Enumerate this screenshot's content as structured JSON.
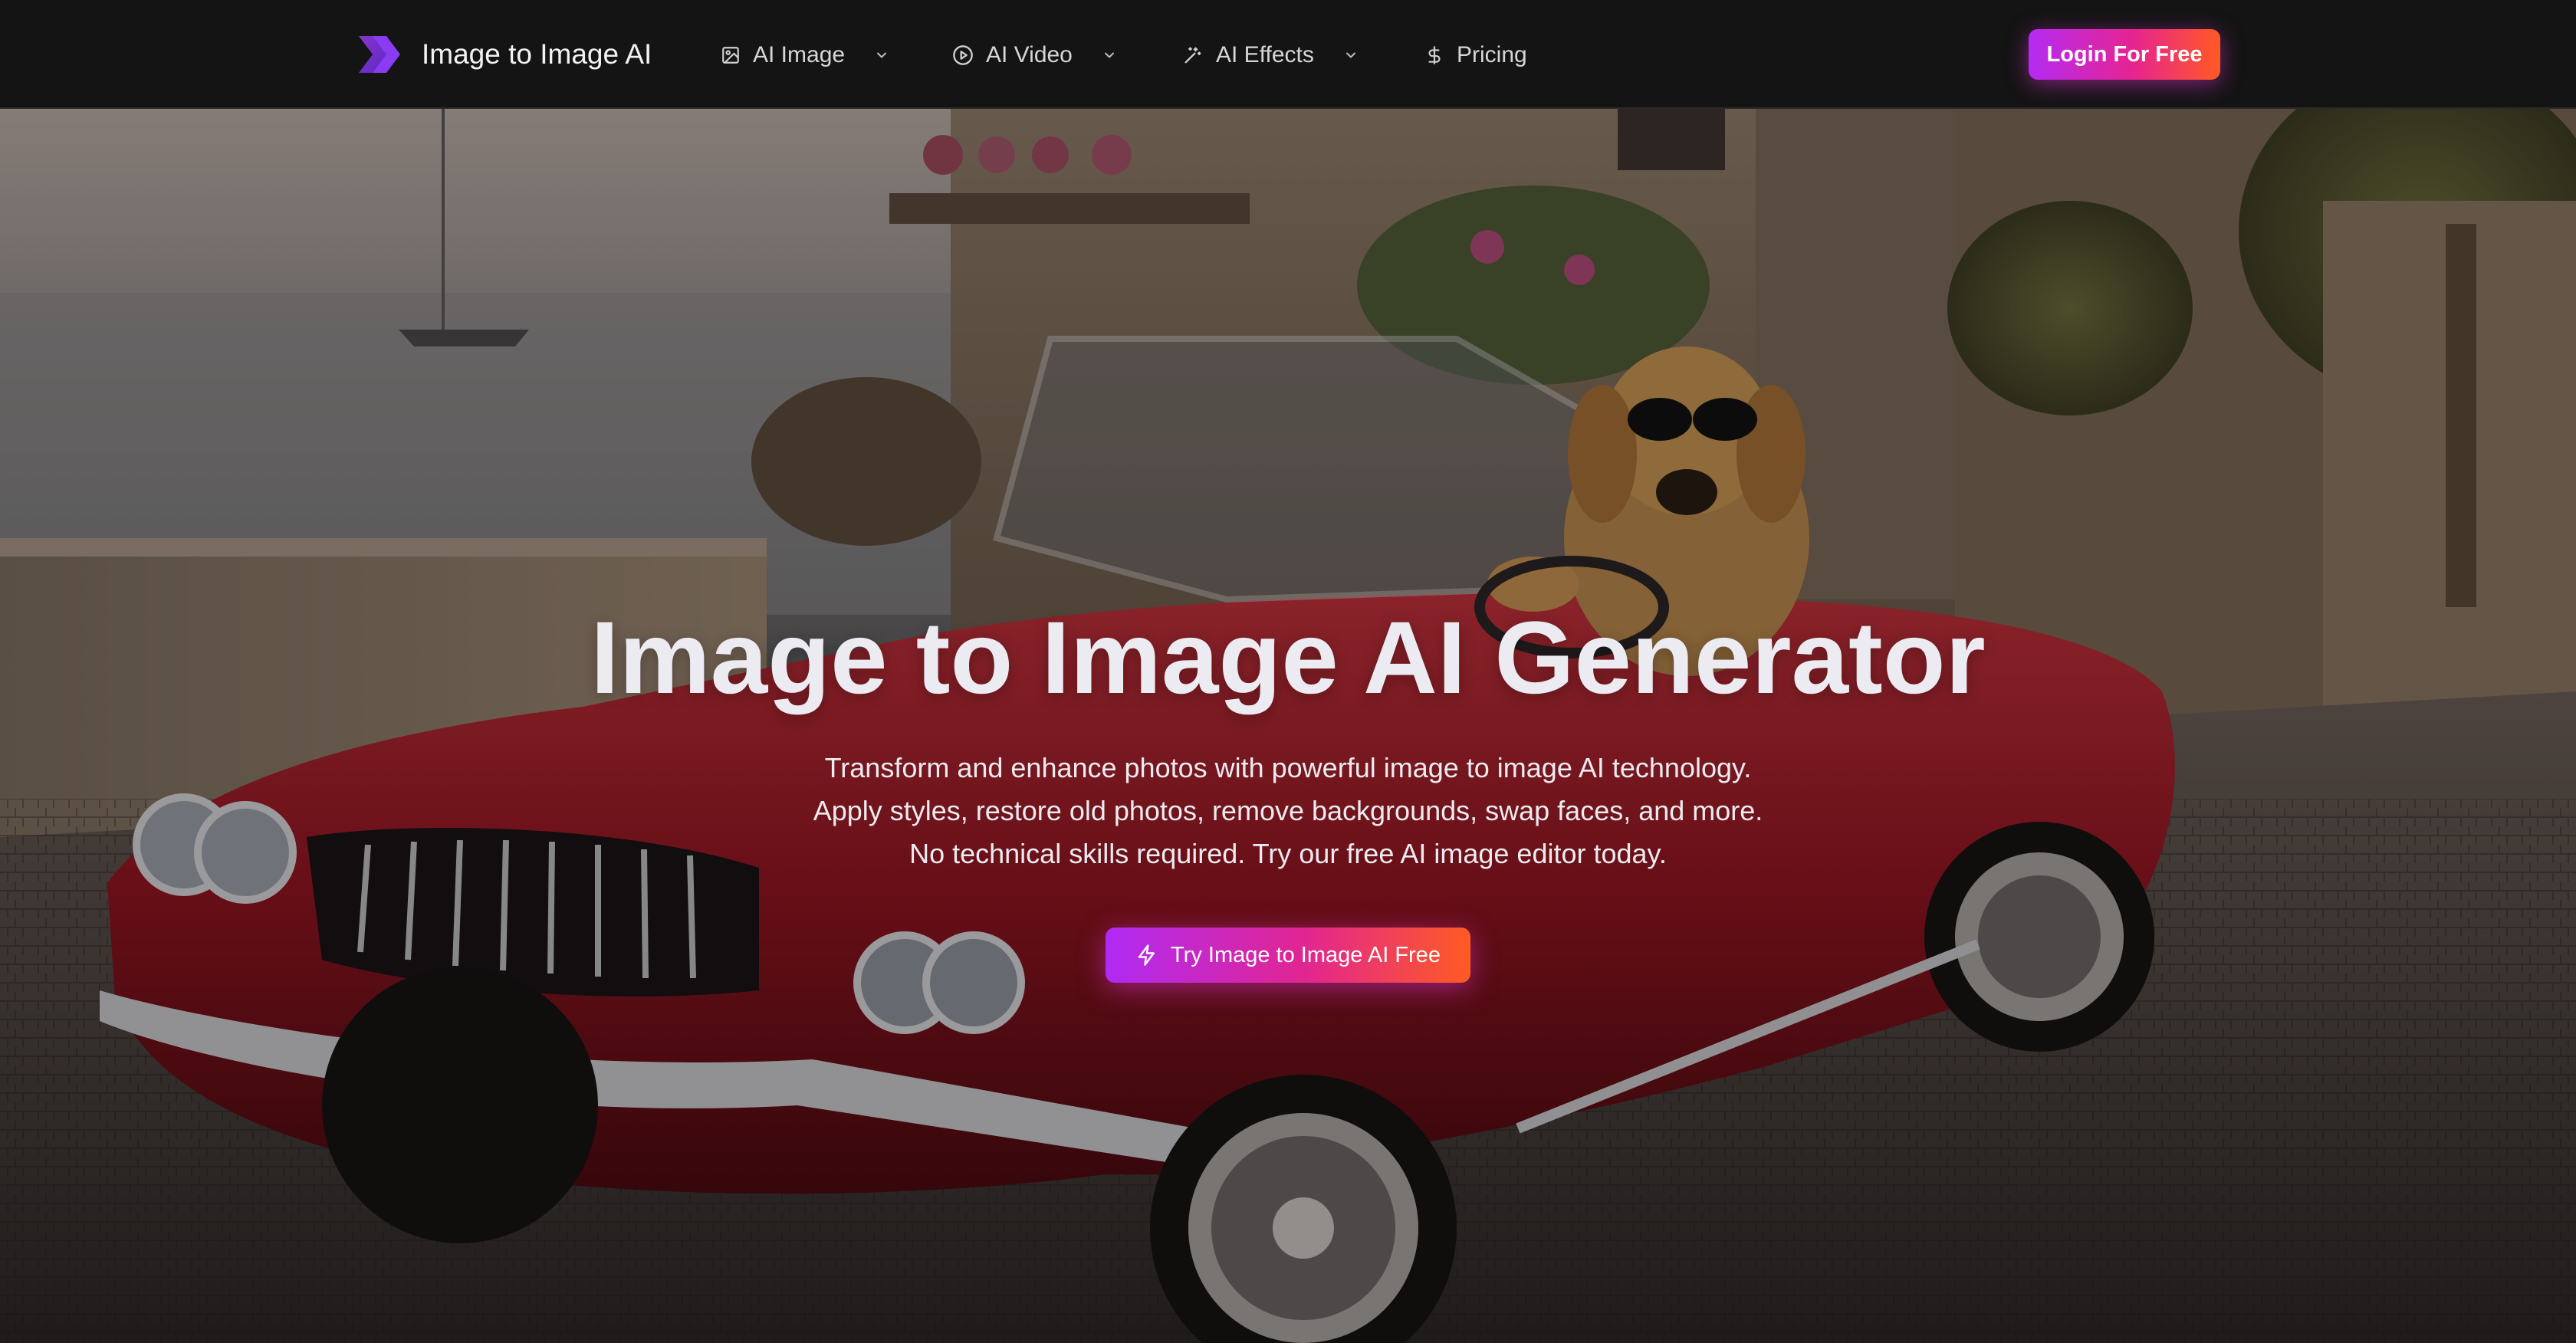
{
  "brand": {
    "name": "Image to Image AI",
    "icon": "chevron-logo-icon"
  },
  "nav": {
    "items": [
      {
        "label": "AI Image",
        "icon": "image-icon",
        "has_dropdown": true
      },
      {
        "label": "AI Video",
        "icon": "play-circle-icon",
        "has_dropdown": true
      },
      {
        "label": "AI Effects",
        "icon": "wand-sparkle-icon",
        "has_dropdown": true
      },
      {
        "label": "Pricing",
        "icon": "dollar-icon",
        "has_dropdown": false
      }
    ],
    "login_label": "Login For Free"
  },
  "hero": {
    "title": "Image to Image AI Generator",
    "subtitle_lines": [
      "Transform and enhance photos with powerful image to image AI technology.",
      "Apply styles, restore old photos, remove backgrounds, swap faces, and more.",
      "No technical skills required. Try our free AI image editor today."
    ],
    "cta_label": "Try Image to Image AI Free",
    "cta_icon": "lightning-icon",
    "background": "dog-in-sunglasses-driving-red-convertible-photo"
  },
  "colors": {
    "nav_bg": "#141414",
    "gradient_start": "#b42bf4",
    "gradient_mid": "#e7248f",
    "gradient_end": "#ff5a23",
    "title_text": "#ecebf2"
  }
}
